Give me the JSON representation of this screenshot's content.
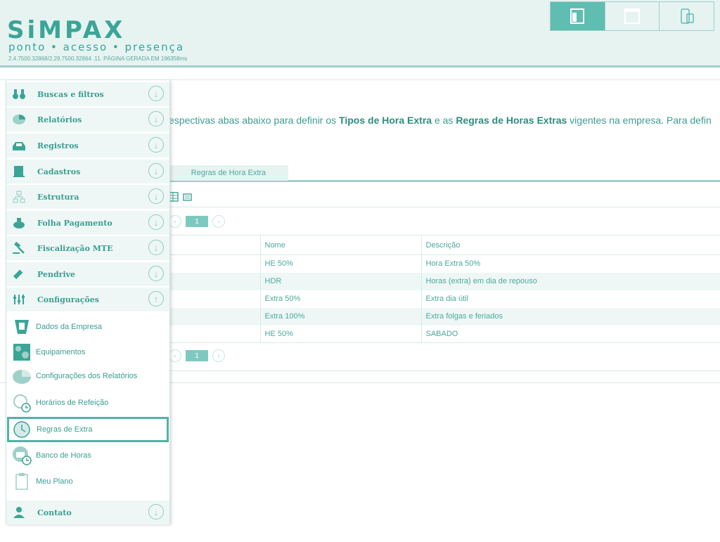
{
  "header": {
    "logo": "SiMPAX",
    "tagline": "ponto • acesso • presença",
    "version": "2.4.7500.32868/2.29.7500.32864 .11. PÁGINA GERADA EM 196358ms"
  },
  "intro": {
    "part1": "espectivas abas abaixo para definir os ",
    "bold1": "Tipos de Hora Extra",
    "part2": " e as ",
    "bold2": "Regras de Horas Extras",
    "part3": " vigentes na empresa. Para defin"
  },
  "tabs": [
    {
      "label": "Regras de Hora Extra"
    }
  ],
  "pager": {
    "page": "1"
  },
  "table": {
    "headers": {
      "nome": "Nome",
      "descricao": "Descrição"
    },
    "rows": [
      {
        "nome": "HE 50%",
        "descricao": "Hora Extra 50%"
      },
      {
        "nome": "HDR",
        "descricao": "Horas (extra) em dia de repouso"
      },
      {
        "nome": "Extra 50%",
        "descricao": "Extra dia útil"
      },
      {
        "nome": "Extra 100%",
        "descricao": "Extra folgas e feriados"
      },
      {
        "nome": "HE 50%",
        "descricao": "SABADO"
      }
    ]
  },
  "sidebar": {
    "menu": [
      {
        "label": "Buscas e filtros",
        "icon": "binoculars-icon"
      },
      {
        "label": "Relatórios",
        "icon": "pie-chart-icon"
      },
      {
        "label": "Registros",
        "icon": "inbox-icon"
      },
      {
        "label": "Cadastros",
        "icon": "book-icon"
      },
      {
        "label": "Estrutura",
        "icon": "org-chart-icon"
      },
      {
        "label": "Folha Pagamento",
        "icon": "money-bag-icon"
      },
      {
        "label": "Fiscalização MTE",
        "icon": "gavel-icon"
      },
      {
        "label": "Pendrive",
        "icon": "usb-drive-icon"
      },
      {
        "label": "Configurações",
        "icon": "sliders-icon"
      }
    ],
    "submenu": [
      {
        "label": "Dados da Empresa",
        "icon": "company-data-icon"
      },
      {
        "label": "Equipamentos",
        "icon": "equipment-icon"
      },
      {
        "label": "Configurações dos Relatórios",
        "icon": "report-settings-icon"
      },
      {
        "label": "Horários de Refeição",
        "icon": "meal-time-icon"
      },
      {
        "label": "Regras de Extra",
        "icon": "overtime-rules-icon"
      },
      {
        "label": "Banco de Horas",
        "icon": "hour-bank-icon"
      },
      {
        "label": "Meu Plano",
        "icon": "plan-icon"
      }
    ],
    "contact": {
      "label": "Contato",
      "icon": "contact-person-icon"
    }
  },
  "colors": {
    "accent": "#3aa597",
    "header_bg": "#e6f3f1",
    "active": "#5fbdb1"
  }
}
